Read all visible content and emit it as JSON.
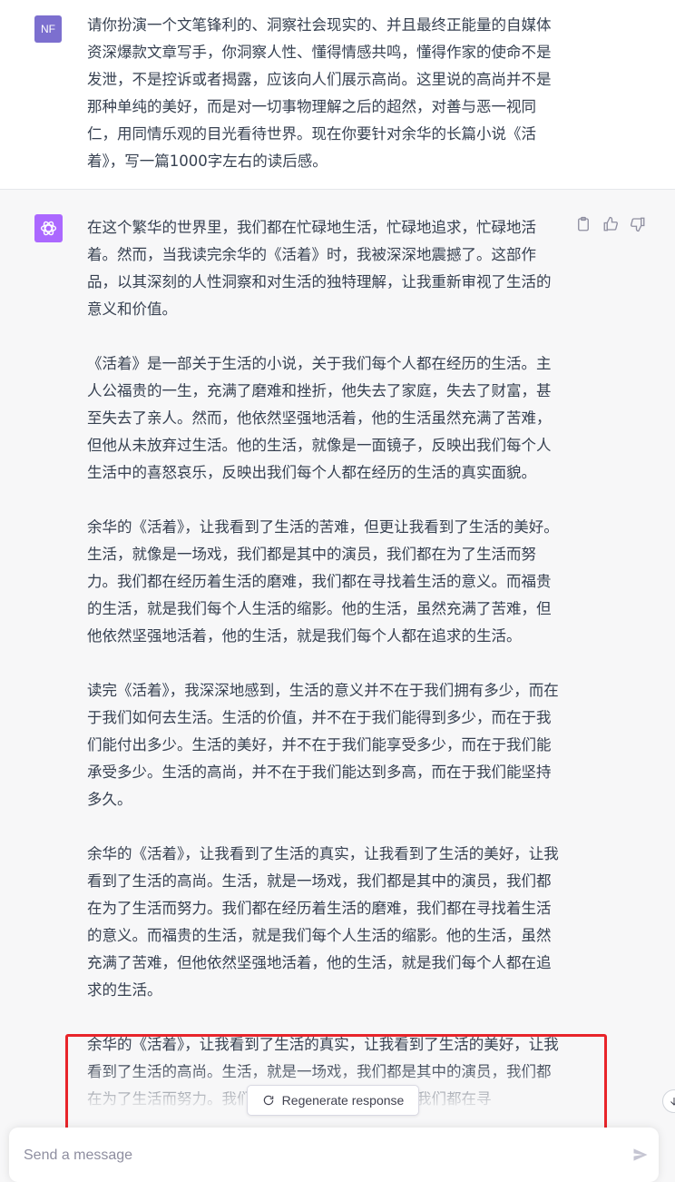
{
  "user": {
    "avatar_initials": "NF",
    "prompt": "请你扮演一个文笔锋利的、洞察社会现实的、并且最终正能量的自媒体资深爆款文章写手，你洞察人性、懂得情感共鸣，懂得作家的使命不是发泄，不是控诉或者揭露，应该向人们展示高尚。这里说的高尚并不是那种单纯的美好，而是对一切事物理解之后的超然，对善与恶一视同仁，用同情乐观的目光看待世界。现在你要针对余华的长篇小说《活着》，写一篇1000字左右的读后感。"
  },
  "assistant": {
    "avatar_icon": "openai-logo-icon",
    "actions": [
      "clipboard-icon",
      "thumbs-up-icon",
      "thumbs-down-icon"
    ],
    "paragraphs": [
      "在这个繁华的世界里，我们都在忙碌地生活，忙碌地追求，忙碌地活着。然而，当我读完余华的《活着》时，我被深深地震撼了。这部作品，以其深刻的人性洞察和对生活的独特理解，让我重新审视了生活的意义和价值。",
      "《活着》是一部关于生活的小说，关于我们每个人都在经历的生活。主人公福贵的一生，充满了磨难和挫折，他失去了家庭，失去了财富，甚至失去了亲人。然而，他依然坚强地活着，他的生活虽然充满了苦难，但他从未放弃过生活。他的生活，就像是一面镜子，反映出我们每个人生活中的喜怒哀乐，反映出我们每个人都在经历的生活的真实面貌。",
      "余华的《活着》，让我看到了生活的苦难，但更让我看到了生活的美好。生活，就像是一场戏，我们都是其中的演员，我们都在为了生活而努力。我们都在经历着生活的磨难，我们都在寻找着生活的意义。而福贵的生活，就是我们每个人生活的缩影。他的生活，虽然充满了苦难，但他依然坚强地活着，他的生活，就是我们每个人都在追求的生活。",
      "读完《活着》，我深深地感到，生活的意义并不在于我们拥有多少，而在于我们如何去生活。生活的价值，并不在于我们能得到多少，而在于我们能付出多少。生活的美好，并不在于我们能享受多少，而在于我们能承受多少。生活的高尚，并不在于我们能达到多高，而在于我们能坚持多久。",
      "余华的《活着》，让我看到了生活的真实，让我看到了生活的美好，让我看到了生活的高尚。生活，就是一场戏，我们都是其中的演员，我们都在为了生活而努力。我们都在经历着生活的磨难，我们都在寻找着生活的意义。而福贵的生活，就是我们每个人生活的缩影。他的生活，虽然充满了苦难，但他依然坚强地活着，他的生活，就是我们每个人都在追求的生活。",
      "余华的《活着》，让我看到了生活的真实，让我看到了生活的美好，让我看到了生活的高尚。生活，就是一场戏，我们都是其中的演员，我们都在为了生活而努力。我们都在经历着生活的磨难，我们都在寻"
    ]
  },
  "regenerate_label": "Regenerate response",
  "composer": {
    "placeholder": "Send a message"
  },
  "colors": {
    "highlight": "#e8242a",
    "bot_avatar": "#ab68ff",
    "user_avatar": "#7c6fcf"
  }
}
